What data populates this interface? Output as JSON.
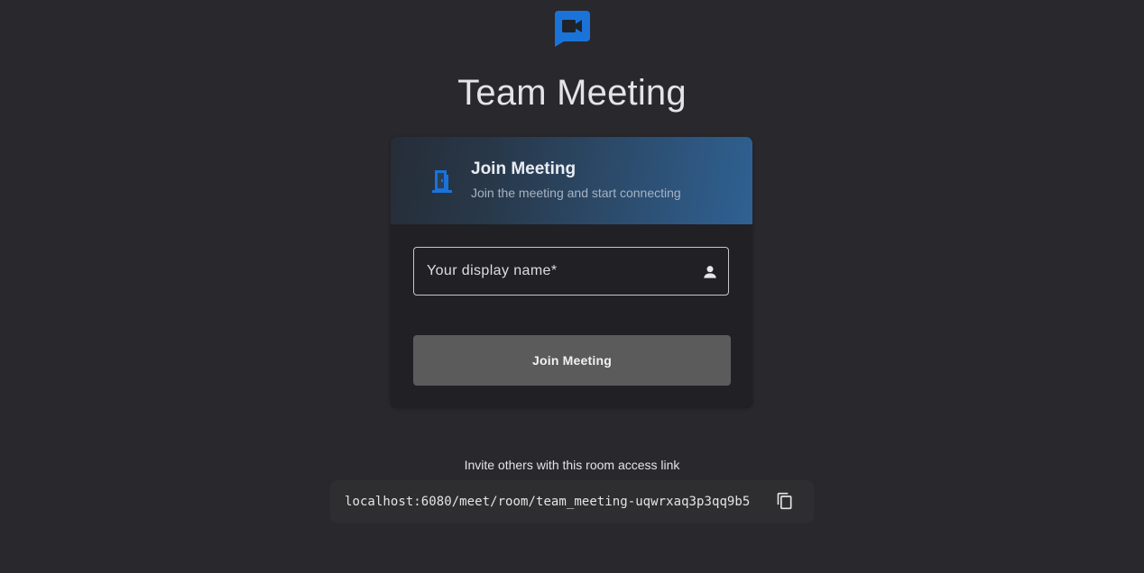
{
  "app": {
    "logo_icon": "video-camera-chat-icon",
    "brand_color": "#1a73d9",
    "title": "Team Meeting"
  },
  "join_card": {
    "header_icon": "door-icon",
    "title": "Join Meeting",
    "subtitle": "Join the meeting and start connecting",
    "name_field": {
      "placeholder": "Your display name*",
      "value": "",
      "icon": "person-icon"
    },
    "join_button_label": "Join Meeting"
  },
  "invite": {
    "label": "Invite others with this room access link",
    "link": "localhost:6080/meet/room/team_meeting-uqwrxaq3p3qq9b5",
    "copy_icon": "copy-icon"
  }
}
